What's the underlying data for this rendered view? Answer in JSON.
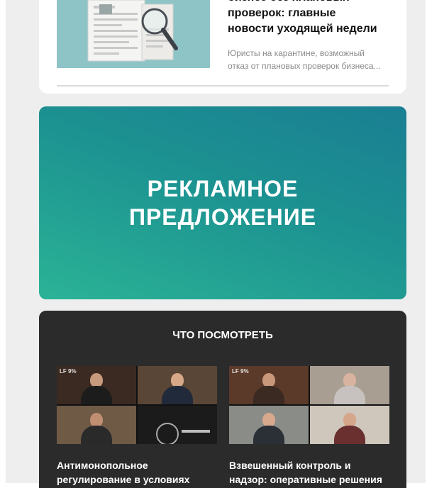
{
  "news": {
    "title": "бизнес без плановых\nпроверок: главные\nновости уходящей недели",
    "description": "Юристы на карантине, возможный\nотказ от плановых проверок бизнеса..."
  },
  "ad": {
    "text": "РЕКЛАМНОЕ\nПРЕДЛОЖЕНИЕ"
  },
  "watch": {
    "title": "ЧТО ПОСМОТРЕТЬ",
    "videos": [
      {
        "tag": "LF 9%",
        "caption": "Антимонопольное\nрегулирование в условиях"
      },
      {
        "tag": "LF 9%",
        "caption": "Взвешенный контроль и\nнадзор: оперативные решения"
      }
    ]
  },
  "colors": {
    "background": "#eeeeee",
    "ad_gradient_top": "#1a7f93",
    "ad_gradient_bottom": "#2bb396",
    "watch_bg": "#2b2b2b"
  }
}
